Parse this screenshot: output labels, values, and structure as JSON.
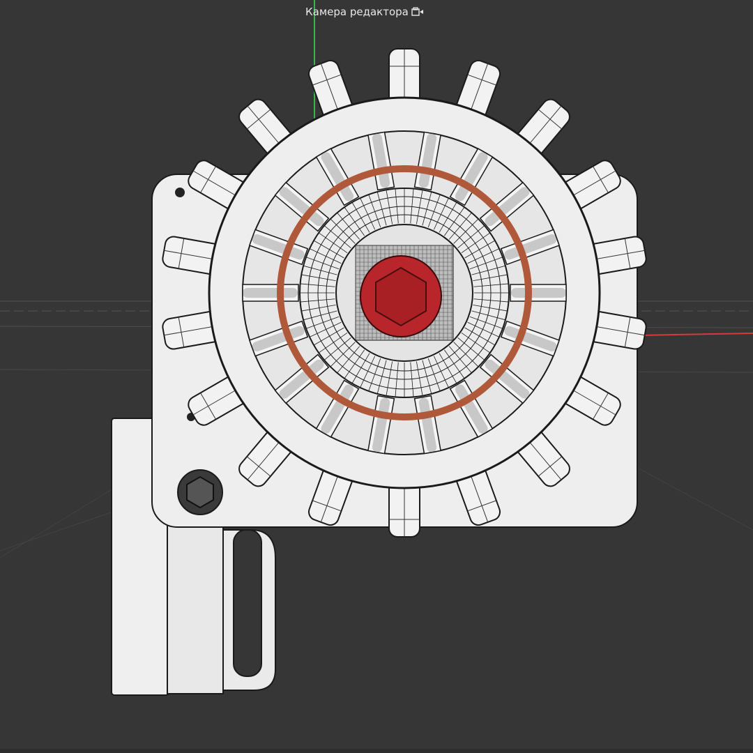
{
  "viewport": {
    "camera_label": "Камера редактора",
    "camera_icon": "camera-icon",
    "background_color": "#363636",
    "axis_colors": {
      "y": "#3fb24f",
      "x": "#d83a3a"
    }
  },
  "model": {
    "body_color": "#efefef",
    "wire_color": "#1a1a1a",
    "center_cap_color": "#b8262b",
    "coil_color": "#b0583a"
  }
}
